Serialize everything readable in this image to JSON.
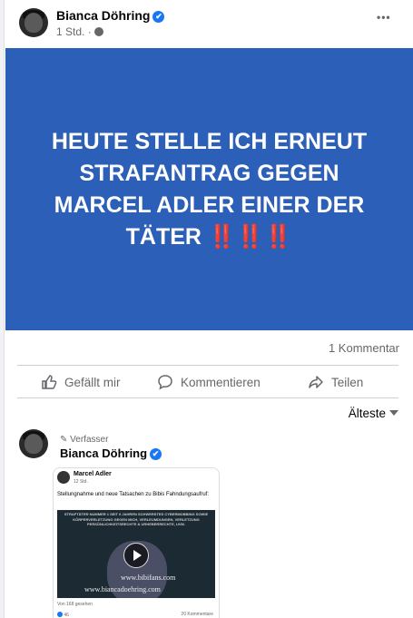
{
  "post": {
    "author": "Bianca Döhring",
    "time": "1 Std. ·",
    "more_label": "•••",
    "banner_text": "HEUTE STELLE ICH ERNEUT STRAFANTRAG GEGEN MARCEL ADLER EINER DER TÄTER",
    "banner_emoji": "‼️‼️‼️",
    "banner_color": "#2c5fb7",
    "comment_count": "1 Kommentar"
  },
  "actions": {
    "like": "Gefällt mir",
    "comment": "Kommentieren",
    "share": "Teilen"
  },
  "sort": {
    "label": "Älteste"
  },
  "comment": {
    "role": "Verfasser",
    "author": "Bianca Döhring",
    "embedded": {
      "author": "Marcel Adler",
      "time": "12 Std.",
      "text": "Stellungnahme und neue Tatsachen zu Bibis Fahndungsaufruf:",
      "video_caption": "STRAFTÄTER NUMMER 1 SEIT 6 JAHREN SCHWERSTES CYBERMOBBING SOWIE KÖRPERVERLETZUNG GEGEN MICH, VERLEUMDUNGEN, VERLETZUNG PERSÖNLICHKEITSRECHTE & URHEBERRECHTE, UVM.",
      "url1": "www.bibifans.com",
      "url2": "www.biancadoehring.com",
      "views": "Von 168 gesehen",
      "likes": "46",
      "comments": "20 Kommentare"
    }
  },
  "colors": {
    "accent": "#1877f2",
    "banner": "#2c5fb7"
  },
  "icons": [
    "globe-icon",
    "more-icon",
    "like-icon",
    "comment-icon",
    "share-icon",
    "caret-down-icon",
    "pencil-icon",
    "verified-icon",
    "play-icon"
  ]
}
